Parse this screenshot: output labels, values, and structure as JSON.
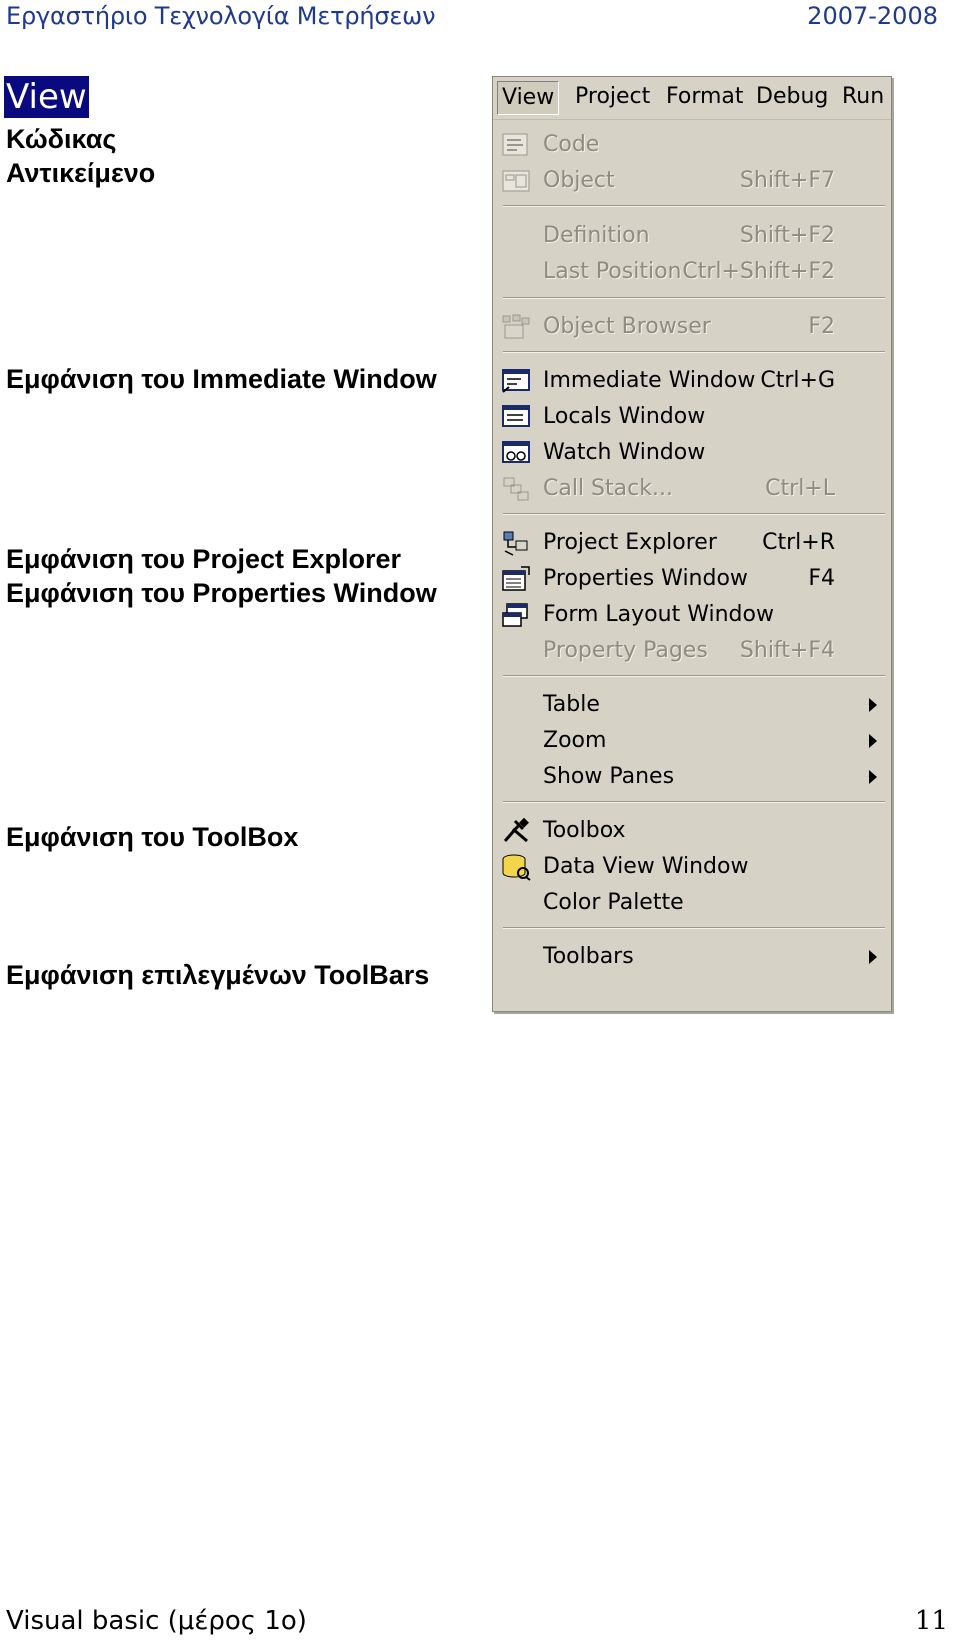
{
  "header": {
    "left": "Εργαστήριο Τεχνολογία Μετρήσεων",
    "right": "2007-2008"
  },
  "section_title": "View",
  "labels": {
    "code": "Κώδικας",
    "object": "Αντικείμενο",
    "immediate": "Εμφάνιση του Immediate Window",
    "project": "Εμφάνιση του Project Explorer",
    "properties": "Εμφάνιση του Properties Window",
    "toolbox": "Εμφάνιση του ToolBox",
    "toolbars": "Εμφάνιση επιλεγμένων ToolBars"
  },
  "menubar": [
    "View",
    "Project",
    "Format",
    "Debug",
    "Run"
  ],
  "menu": {
    "items": [
      {
        "label": "Code",
        "shortcut": "",
        "icon": "code-icon",
        "enabled": false
      },
      {
        "label": "Object",
        "shortcut": "Shift+F7",
        "icon": "object-icon",
        "enabled": false
      },
      {
        "label": "Definition",
        "shortcut": "Shift+F2",
        "icon": "",
        "enabled": false
      },
      {
        "label": "Last Position",
        "shortcut": "Ctrl+Shift+F2",
        "icon": "",
        "enabled": false
      },
      {
        "label": "Object Browser",
        "shortcut": "F2",
        "icon": "object-browser-icon",
        "enabled": false
      },
      {
        "label": "Immediate Window",
        "shortcut": "Ctrl+G",
        "icon": "immediate-window-icon",
        "enabled": true
      },
      {
        "label": "Locals Window",
        "shortcut": "",
        "icon": "locals-window-icon",
        "enabled": true
      },
      {
        "label": "Watch Window",
        "shortcut": "",
        "icon": "watch-window-icon",
        "enabled": true
      },
      {
        "label": "Call Stack...",
        "shortcut": "Ctrl+L",
        "icon": "call-stack-icon",
        "enabled": false
      },
      {
        "label": "Project Explorer",
        "shortcut": "Ctrl+R",
        "icon": "project-explorer-icon",
        "enabled": true
      },
      {
        "label": "Properties Window",
        "shortcut": "F4",
        "icon": "properties-window-icon",
        "enabled": true
      },
      {
        "label": "Form Layout Window",
        "shortcut": "",
        "icon": "form-layout-icon",
        "enabled": true
      },
      {
        "label": "Property Pages",
        "shortcut": "Shift+F4",
        "icon": "",
        "enabled": false
      },
      {
        "label": "Table",
        "shortcut": "",
        "icon": "",
        "enabled": true
      },
      {
        "label": "Zoom",
        "shortcut": "",
        "icon": "",
        "enabled": true
      },
      {
        "label": "Show Panes",
        "shortcut": "",
        "icon": "",
        "enabled": true
      },
      {
        "label": "Toolbox",
        "shortcut": "",
        "icon": "toolbox-icon",
        "enabled": true
      },
      {
        "label": "Data View Window",
        "shortcut": "",
        "icon": "data-view-icon",
        "enabled": true
      },
      {
        "label": "Color Palette",
        "shortcut": "",
        "icon": "",
        "enabled": true
      },
      {
        "label": "Toolbars",
        "shortcut": "",
        "icon": "",
        "enabled": true
      }
    ]
  },
  "footer": {
    "left": "Visual basic  (μέρος 1ο)",
    "page": "11"
  }
}
